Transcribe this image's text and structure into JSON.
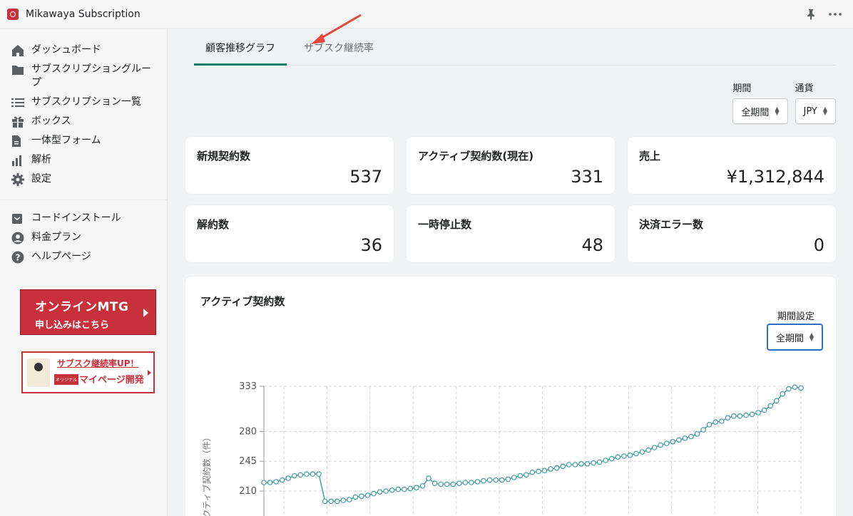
{
  "app": {
    "title": "Mikawaya Subscription",
    "pin_icon": "pin-icon",
    "more_icon": "more-horizontal-icon"
  },
  "sidebar": {
    "items": [
      {
        "label": "ダッシュボード",
        "icon": "home-icon"
      },
      {
        "label": "サブスクリプショングループ",
        "icon": "folder-icon"
      },
      {
        "label": "サブスクリプション一覧",
        "icon": "list-icon"
      },
      {
        "label": "ボックス",
        "icon": "gift-icon"
      },
      {
        "label": "一体型フォーム",
        "icon": "document-icon"
      },
      {
        "label": "解析",
        "icon": "bar-chart-icon"
      },
      {
        "label": "設定",
        "icon": "gear-icon"
      }
    ],
    "secondary_items": [
      {
        "label": "コードインストール",
        "icon": "code-install-icon"
      },
      {
        "label": "料金プラン",
        "icon": "user-circle-icon"
      },
      {
        "label": "ヘルプページ",
        "icon": "help-icon"
      }
    ],
    "mtg_banner": {
      "line1": "オンラインMTG",
      "line2": "申し込みはこちら"
    },
    "mypage_banner": {
      "line1": "サブスク継続率UP！",
      "badge": "オリジナル",
      "line2": "マイページ開発"
    }
  },
  "tabs": [
    {
      "label": "顧客推移グラフ",
      "active": true
    },
    {
      "label": "サブスク継続率",
      "active": false
    }
  ],
  "filters": {
    "period": {
      "label": "期間",
      "value": "全期間"
    },
    "currency": {
      "label": "通貨",
      "value": "JPY"
    }
  },
  "stats": [
    {
      "label": "新規契約数",
      "value": "537"
    },
    {
      "label": "アクティブ契約数(現在)",
      "value": "331"
    },
    {
      "label": "売上",
      "value": "¥1,312,844"
    },
    {
      "label": "解約数",
      "value": "36"
    },
    {
      "label": "一時停止数",
      "value": "48"
    },
    {
      "label": "決済エラー数",
      "value": "0"
    }
  ],
  "chart_section": {
    "title": "アクティブ契約数",
    "period_label": "期間設定",
    "period_value": "全期間"
  },
  "colors": {
    "accent_tab": "#008060",
    "brand_red": "#c8313c",
    "line": "#3f9ea3",
    "focus": "#2c6ecb"
  },
  "chart_data": {
    "type": "line",
    "ylabel": "アクティブ契約数（件）",
    "yticks": [
      333,
      280,
      245,
      210
    ],
    "ylim": [
      195,
      336
    ],
    "grid": true,
    "series": [
      {
        "values": [
          220,
          220,
          221,
          223,
          225,
          228,
          229,
          230,
          230,
          230,
          198,
          198,
          198,
          199,
          200,
          203,
          204,
          205,
          207,
          209,
          210,
          211,
          212,
          212,
          213,
          214,
          216,
          225,
          219,
          218,
          218,
          218,
          219,
          220,
          220,
          221,
          222,
          223,
          223,
          223,
          224,
          226,
          228,
          229,
          232,
          233,
          234,
          236,
          237,
          239,
          241,
          241,
          242,
          242,
          243,
          244,
          246,
          248,
          250,
          251,
          252,
          254,
          256,
          258,
          261,
          264,
          266,
          268,
          270,
          272,
          274,
          277,
          282,
          288,
          291,
          292,
          296,
          298,
          298,
          299,
          300,
          302,
          305,
          310,
          316,
          324,
          330,
          332,
          331
        ]
      }
    ]
  }
}
